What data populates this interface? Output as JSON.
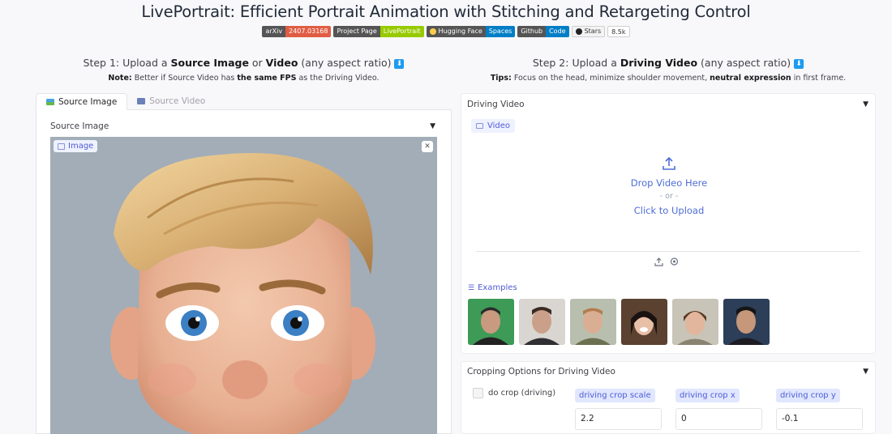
{
  "page": {
    "title": "LivePortrait: Efficient Portrait Animation with Stitching and Retargeting Control"
  },
  "badges": [
    {
      "left": "arXiv",
      "right": "2407.03168",
      "color": "#e05d44"
    },
    {
      "left": "Project Page",
      "right": "LivePortrait",
      "color": "#97ca00"
    },
    {
      "left": "Hugging Face",
      "right": "Spaces",
      "color": "#007ec6"
    },
    {
      "left": "Github",
      "right": "Code",
      "color": "#007ec6"
    }
  ],
  "stars": {
    "label": "Stars",
    "count": "8.5k"
  },
  "step1": {
    "prefix": "Step 1: Upload a ",
    "bold1": "Source Image",
    "mid": " or ",
    "bold2": "Video",
    "suffix": " (any aspect ratio) ",
    "note_label": "Note:",
    "note_text1": " Better if Source Video has ",
    "note_bold": "the same FPS",
    "note_text2": " as the Driving Video."
  },
  "step2": {
    "prefix": "Step 2: Upload a ",
    "bold1": "Driving Video",
    "suffix": " (any aspect ratio) ",
    "tips_label": "Tips:",
    "tips_text1": " Focus on the head, minimize shoulder movement, ",
    "tips_bold": "neutral expression",
    "tips_text2": " in first frame."
  },
  "left": {
    "tabs": [
      "Source Image",
      "Source Video"
    ],
    "panel_label": "Source Image",
    "image_chip": "Image",
    "close": "✕"
  },
  "driving": {
    "panel_label": "Driving Video",
    "video_chip": "Video",
    "drop_text": "Drop Video Here",
    "or_text": "- or -",
    "click_text": "Click to Upload",
    "examples_label": "Examples"
  },
  "cropping": {
    "panel_label": "Cropping Options for Driving Video",
    "checkbox_label": "do crop (driving)",
    "fields": [
      {
        "label": "driving crop scale",
        "value": "2.2"
      },
      {
        "label": "driving crop x",
        "value": "0"
      },
      {
        "label": "driving crop y",
        "value": "-0.1"
      }
    ]
  },
  "colors": {
    "accent": "#4f5bd5",
    "chip_bg": "#eef2ff"
  },
  "icons": [
    "download-icon",
    "image-icon",
    "video-icon",
    "upload-icon",
    "webcam-icon",
    "list-icon",
    "github-icon",
    "huggingface-icon",
    "chevron-down-icon",
    "close-icon"
  ]
}
